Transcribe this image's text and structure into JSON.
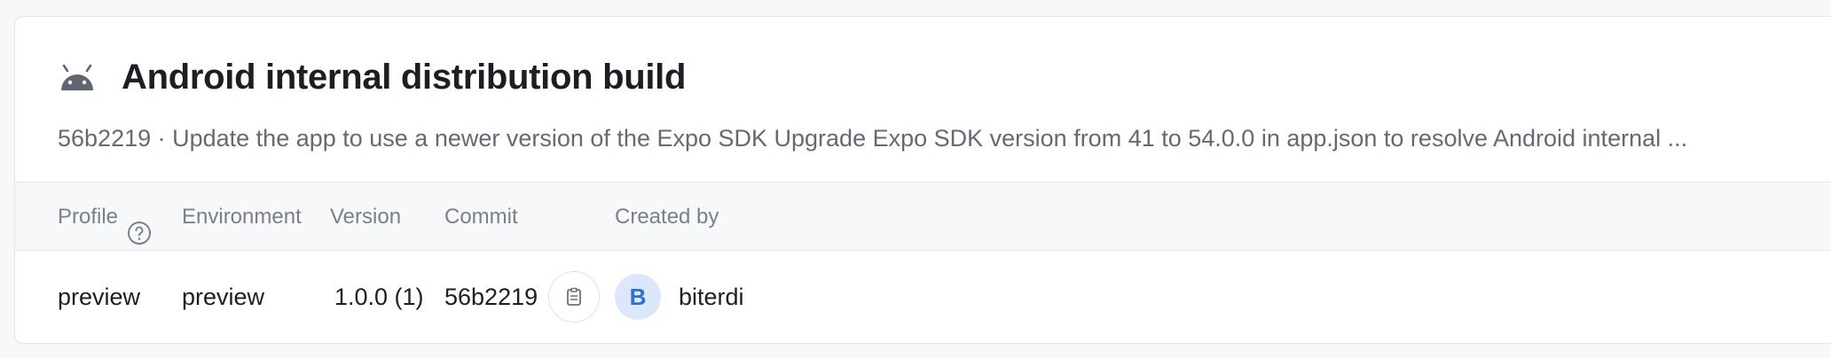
{
  "build": {
    "platform_icon": "android-icon",
    "title": "Android internal distribution build",
    "subtitle": "56b2219 · Update the app to use a newer version of the Expo SDK Upgrade Expo SDK version from 41 to 54.0.0 in app.json to resolve Android internal ..."
  },
  "table": {
    "headers": {
      "profile": "Profile",
      "environment": "Environment",
      "version": "Version",
      "commit": "Commit",
      "created_by": "Created by"
    },
    "row": {
      "profile": "preview",
      "environment": "preview",
      "version": "1.0.0 (1)",
      "commit": "56b2219",
      "avatar_initial": "B",
      "created_by": "biterdi"
    }
  },
  "colors": {
    "avatar_bg": "#dbe8fb",
    "avatar_text": "#2f6fd3"
  }
}
